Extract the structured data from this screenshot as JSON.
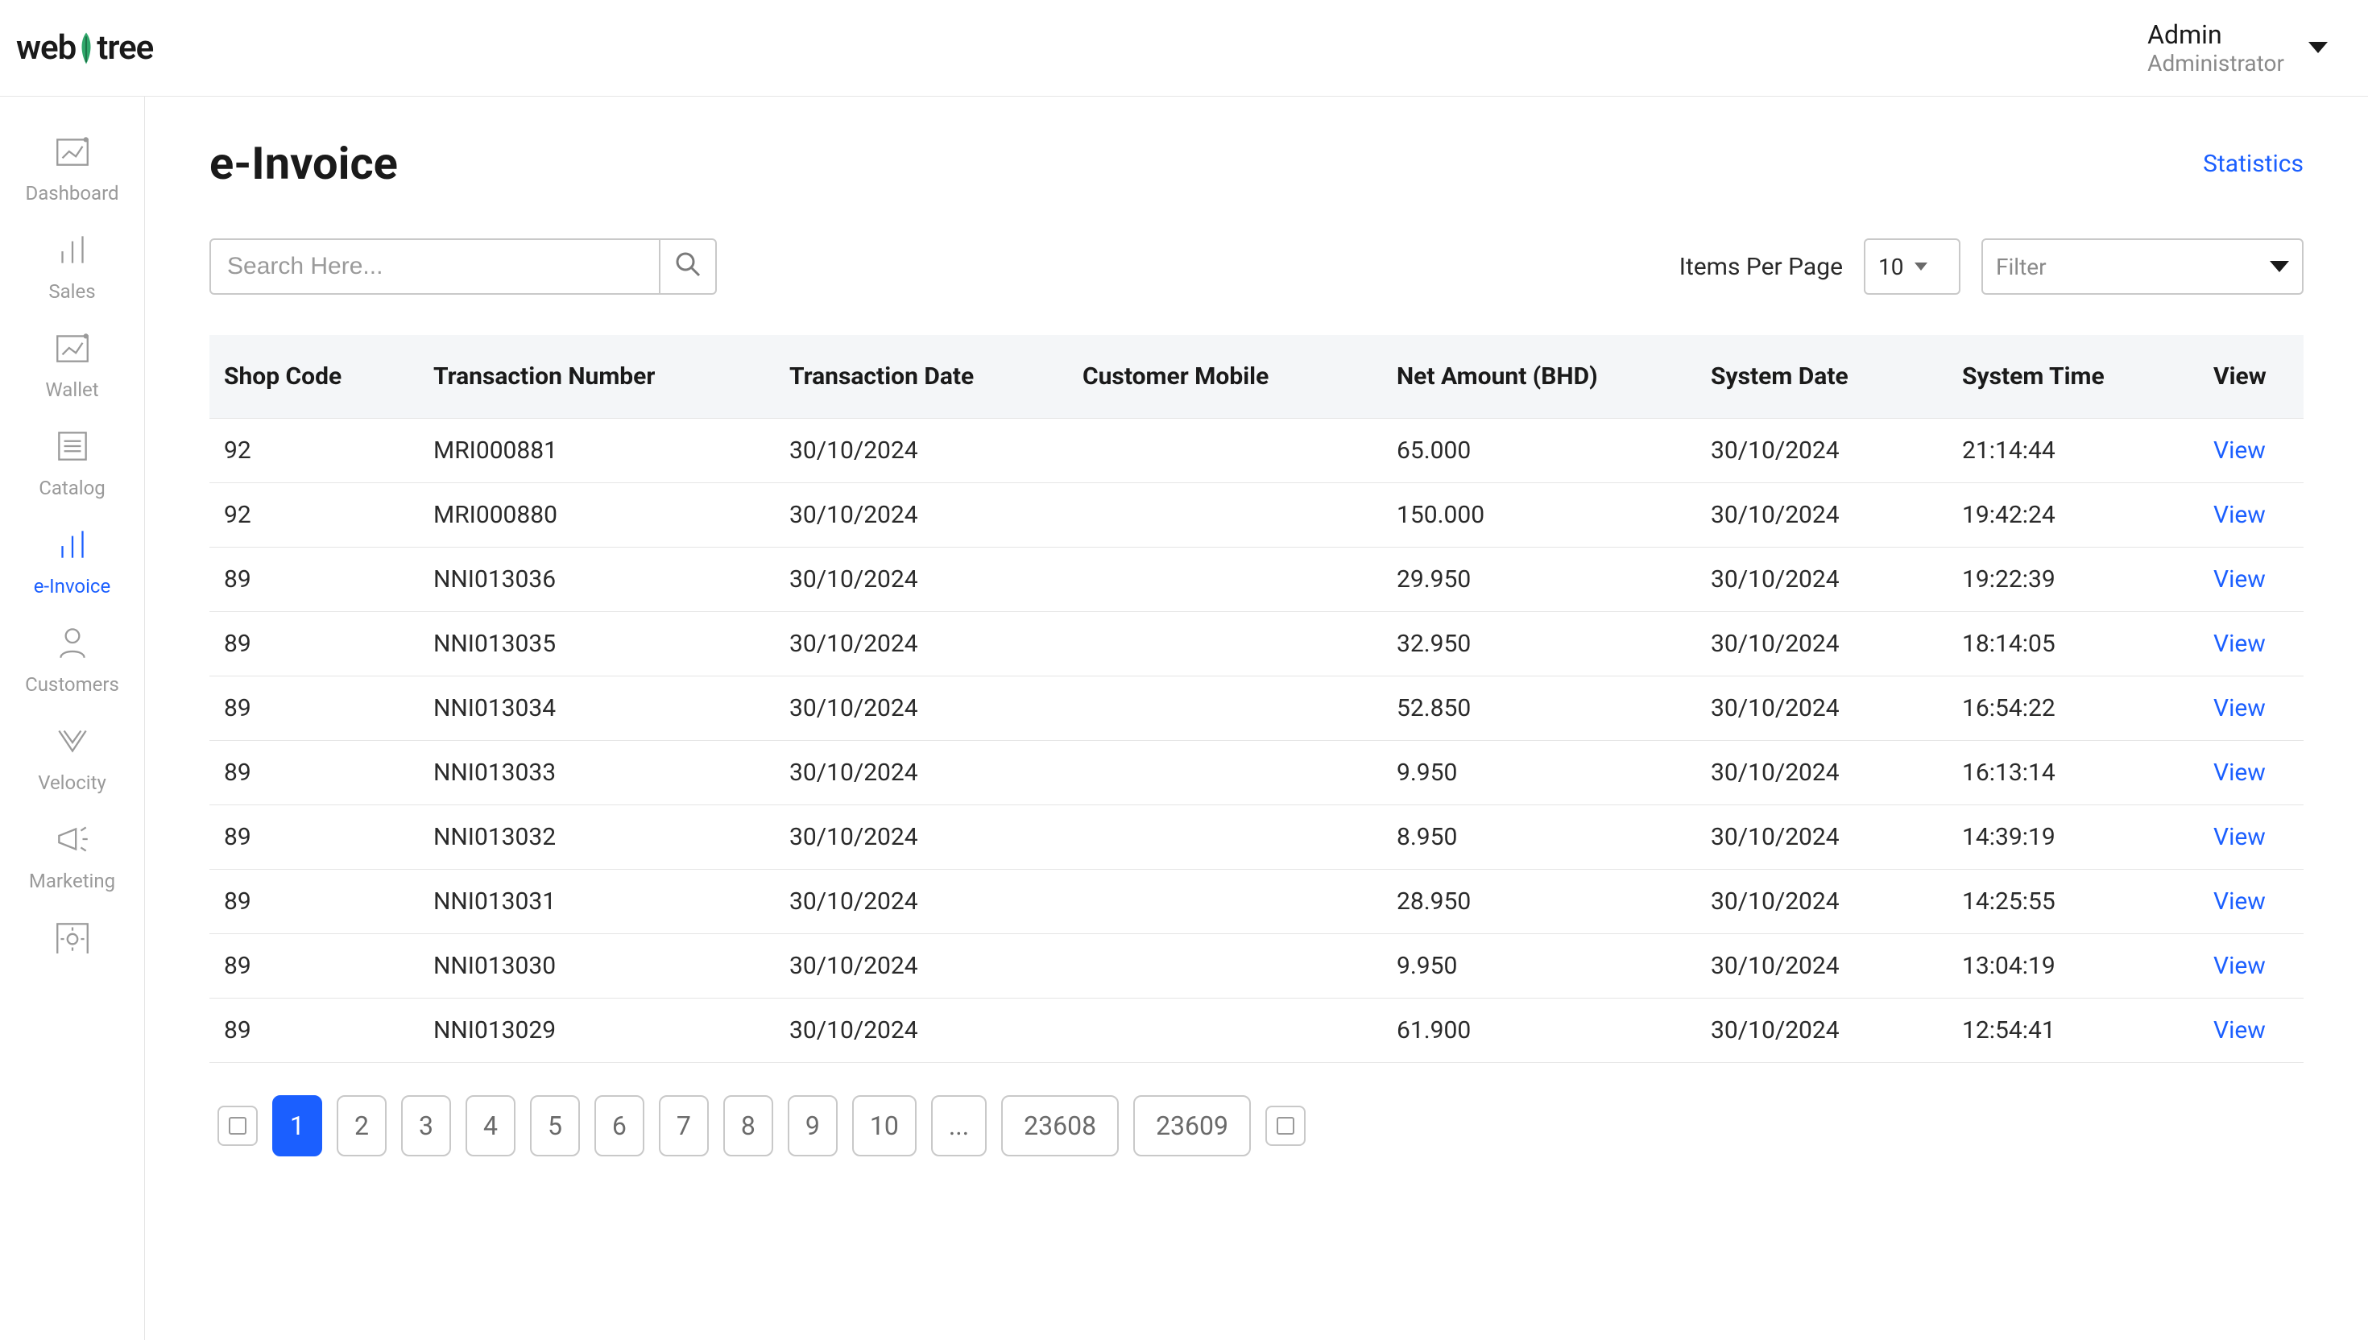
{
  "brand": {
    "name_left": "web",
    "name_right": "tree"
  },
  "user": {
    "name": "Admin",
    "role": "Administrator"
  },
  "sidebar": {
    "items": [
      {
        "label": "Dashboard"
      },
      {
        "label": "Sales"
      },
      {
        "label": "Wallet"
      },
      {
        "label": "Catalog"
      },
      {
        "label": "e-Invoice"
      },
      {
        "label": "Customers"
      },
      {
        "label": "Velocity"
      },
      {
        "label": "Marketing"
      }
    ]
  },
  "page": {
    "title": "e-Invoice",
    "statistics_label": "Statistics",
    "search_placeholder": "Search Here...",
    "items_per_page_label": "Items Per Page",
    "items_per_page_value": "10",
    "filter_placeholder": "Filter"
  },
  "table": {
    "headers": {
      "shop_code": "Shop Code",
      "txn_number": "Transaction Number",
      "txn_date": "Transaction Date",
      "customer_mobile": "Customer Mobile",
      "net_amount": "Net Amount (BHD)",
      "system_date": "System Date",
      "system_time": "System Time",
      "view": "View"
    },
    "view_label": "View",
    "rows": [
      {
        "shop_code": "92",
        "txn_number": "MRI000881",
        "txn_date": "30/10/2024",
        "customer_mobile": "",
        "net_amount": "65.000",
        "system_date": "30/10/2024",
        "system_time": "21:14:44"
      },
      {
        "shop_code": "92",
        "txn_number": "MRI000880",
        "txn_date": "30/10/2024",
        "customer_mobile": "",
        "net_amount": "150.000",
        "system_date": "30/10/2024",
        "system_time": "19:42:24"
      },
      {
        "shop_code": "89",
        "txn_number": "NNI013036",
        "txn_date": "30/10/2024",
        "customer_mobile": "",
        "net_amount": "29.950",
        "system_date": "30/10/2024",
        "system_time": "19:22:39"
      },
      {
        "shop_code": "89",
        "txn_number": "NNI013035",
        "txn_date": "30/10/2024",
        "customer_mobile": "",
        "net_amount": "32.950",
        "system_date": "30/10/2024",
        "system_time": "18:14:05"
      },
      {
        "shop_code": "89",
        "txn_number": "NNI013034",
        "txn_date": "30/10/2024",
        "customer_mobile": "",
        "net_amount": "52.850",
        "system_date": "30/10/2024",
        "system_time": "16:54:22"
      },
      {
        "shop_code": "89",
        "txn_number": "NNI013033",
        "txn_date": "30/10/2024",
        "customer_mobile": "",
        "net_amount": "9.950",
        "system_date": "30/10/2024",
        "system_time": "16:13:14"
      },
      {
        "shop_code": "89",
        "txn_number": "NNI013032",
        "txn_date": "30/10/2024",
        "customer_mobile": "",
        "net_amount": "8.950",
        "system_date": "30/10/2024",
        "system_time": "14:39:19"
      },
      {
        "shop_code": "89",
        "txn_number": "NNI013031",
        "txn_date": "30/10/2024",
        "customer_mobile": "",
        "net_amount": "28.950",
        "system_date": "30/10/2024",
        "system_time": "14:25:55"
      },
      {
        "shop_code": "89",
        "txn_number": "NNI013030",
        "txn_date": "30/10/2024",
        "customer_mobile": "",
        "net_amount": "9.950",
        "system_date": "30/10/2024",
        "system_time": "13:04:19"
      },
      {
        "shop_code": "89",
        "txn_number": "NNI013029",
        "txn_date": "30/10/2024",
        "customer_mobile": "",
        "net_amount": "61.900",
        "system_date": "30/10/2024",
        "system_time": "12:54:41"
      }
    ]
  },
  "pagination": {
    "pages": [
      "1",
      "2",
      "3",
      "4",
      "5",
      "6",
      "7",
      "8",
      "9",
      "10",
      "...",
      "23608",
      "23609"
    ],
    "active": "1"
  }
}
